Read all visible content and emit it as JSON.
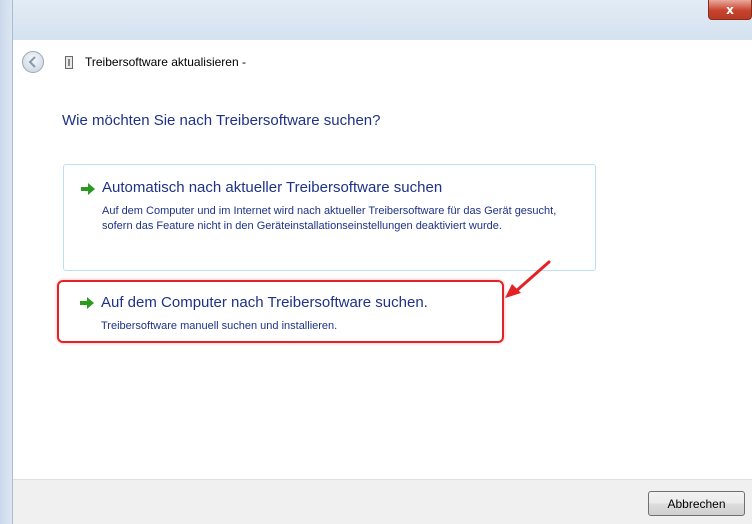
{
  "window": {
    "title": "Treibersoftware aktualisieren -",
    "close_label": "x"
  },
  "main": {
    "question": "Wie möchten Sie nach Treibersoftware suchen?",
    "options": [
      {
        "title": "Automatisch nach aktueller Treibersoftware suchen",
        "description": "Auf dem Computer und im Internet wird nach aktueller Treibersoftware für das Gerät gesucht, sofern das Feature nicht in den Geräteinstallationseinstellungen deaktiviert wurde.",
        "icon": "green-arrow-icon"
      },
      {
        "title": "Auf dem Computer nach Treibersoftware suchen.",
        "description": "Treibersoftware manuell suchen und installieren.",
        "icon": "green-arrow-icon",
        "highlighted": true
      }
    ]
  },
  "footer": {
    "cancel_label": "Abbrechen"
  },
  "colors": {
    "link_blue": "#1e3287",
    "highlight_red": "#e32227",
    "arrow_green": "#2c9a1e",
    "option_border": "#bfe0f3"
  }
}
